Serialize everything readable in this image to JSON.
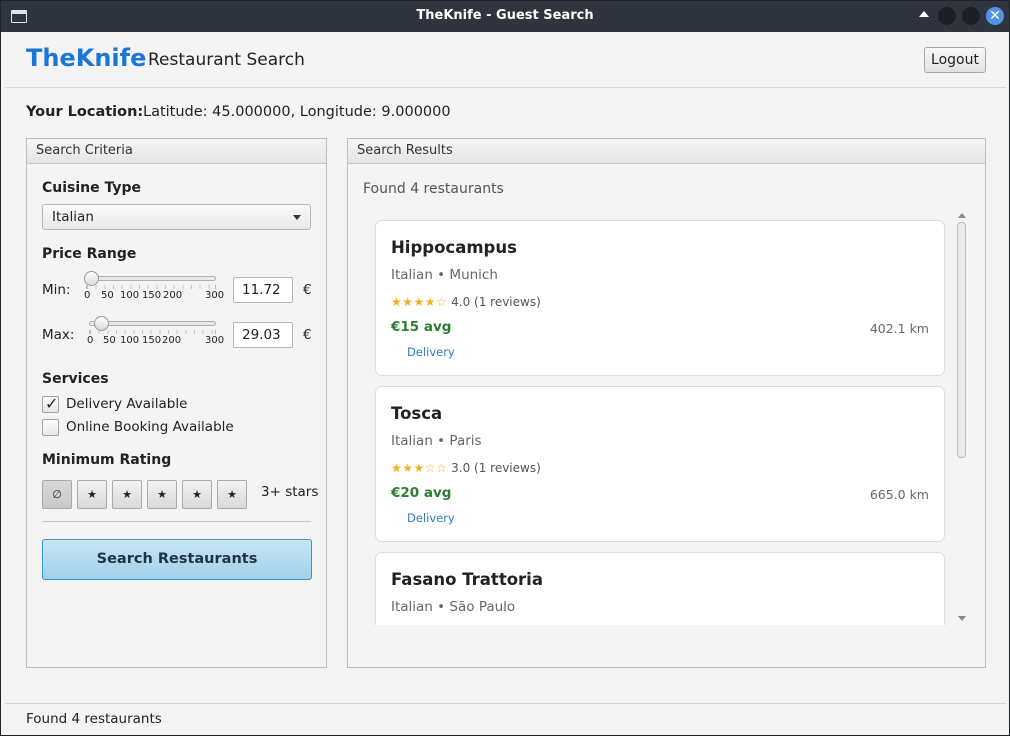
{
  "window": {
    "title": "TheKnife - Guest Search"
  },
  "header": {
    "brand": "TheKnife",
    "subtitle": "Restaurant Search",
    "logout_label": "Logout"
  },
  "location": {
    "label": "Your Location:",
    "value": "Latitude: 45.000000, Longitude: 9.000000"
  },
  "criteria": {
    "panel_title": "Search Criteria",
    "cuisine": {
      "label": "Cuisine Type",
      "selected": "Italian"
    },
    "price": {
      "label": "Price Range",
      "currency": "€",
      "tick_labels": [
        "0",
        "50",
        "100",
        "150",
        "200",
        "300"
      ],
      "min": {
        "label": "Min:",
        "value": "11.72",
        "slider_fraction": 0.039
      },
      "max": {
        "label": "Max:",
        "value": "29.03",
        "slider_fraction": 0.097
      }
    },
    "services": {
      "label": "Services",
      "options": [
        {
          "label": "Delivery Available",
          "checked": true
        },
        {
          "label": "Online Booking Available",
          "checked": false
        }
      ]
    },
    "rating": {
      "label": "Minimum Rating",
      "buttons": [
        "∅",
        "★",
        "★",
        "★",
        "★",
        "★"
      ],
      "hint": "3+ stars"
    },
    "search_label": "Search Restaurants"
  },
  "results": {
    "panel_title": "Search Results",
    "found_text": "Found 4 restaurants",
    "items": [
      {
        "name": "Hippocampus",
        "meta": "Italian • Munich",
        "stars": "★★★★☆",
        "rating_text": "4.0 (1 reviews)",
        "price": "€15 avg",
        "distance": "402.1 km",
        "tag": "Delivery"
      },
      {
        "name": "Tosca",
        "meta": "Italian • Paris",
        "stars": "★★★☆☆",
        "rating_text": "3.0 (1 reviews)",
        "price": "€20 avg",
        "distance": "665.0 km",
        "tag": "Delivery"
      },
      {
        "name": "Fasano Trattoria",
        "meta": "Italian • São Paulo",
        "stars": "",
        "rating_text": "",
        "price": "",
        "distance": "",
        "tag": ""
      }
    ]
  },
  "status": {
    "text": "Found 4 restaurants"
  },
  "colors": {
    "brand": "#1b77d3",
    "price": "#2e7d32",
    "star": "#f2b01e",
    "primary_button": "#9fd0ea"
  }
}
